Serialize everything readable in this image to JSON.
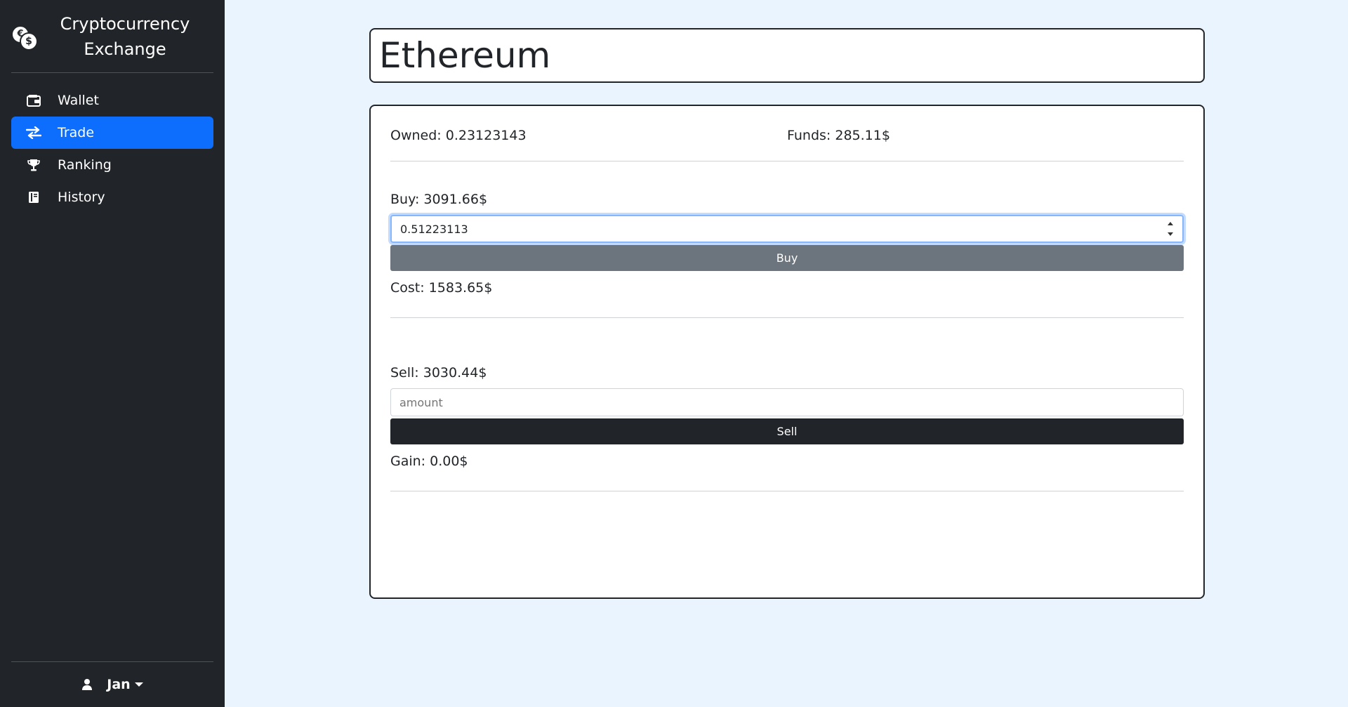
{
  "sidebar": {
    "brand_title_line1": "Cryptocurrency",
    "brand_title_line2": "Exchange",
    "items": [
      {
        "label": "Wallet",
        "icon": "wallet-icon",
        "active": false
      },
      {
        "label": "Trade",
        "icon": "exchange-arrows-icon",
        "active": true
      },
      {
        "label": "Ranking",
        "icon": "trophy-icon",
        "active": false
      },
      {
        "label": "History",
        "icon": "book-icon",
        "active": false
      }
    ],
    "user": {
      "name": "Jan",
      "icon": "user-icon"
    }
  },
  "main": {
    "coin_title": "Ethereum",
    "owned": "Owned: 0.23123143",
    "funds": "Funds: 285.11$",
    "buy": {
      "price_label": "Buy: 3091.66$",
      "input_value": "0.51223113",
      "button_label": "Buy",
      "cost_label": "Cost: 1583.65$"
    },
    "sell": {
      "price_label": "Sell: 3030.44$",
      "input_placeholder": "amount",
      "button_label": "Sell",
      "gain_label": "Gain: 0.00$"
    }
  },
  "colors": {
    "sidebar_bg": "#212529",
    "active_nav": "#0d6efd",
    "main_bg": "#eaf4ff",
    "buy_button": "#6c757d",
    "sell_button": "#212529"
  }
}
